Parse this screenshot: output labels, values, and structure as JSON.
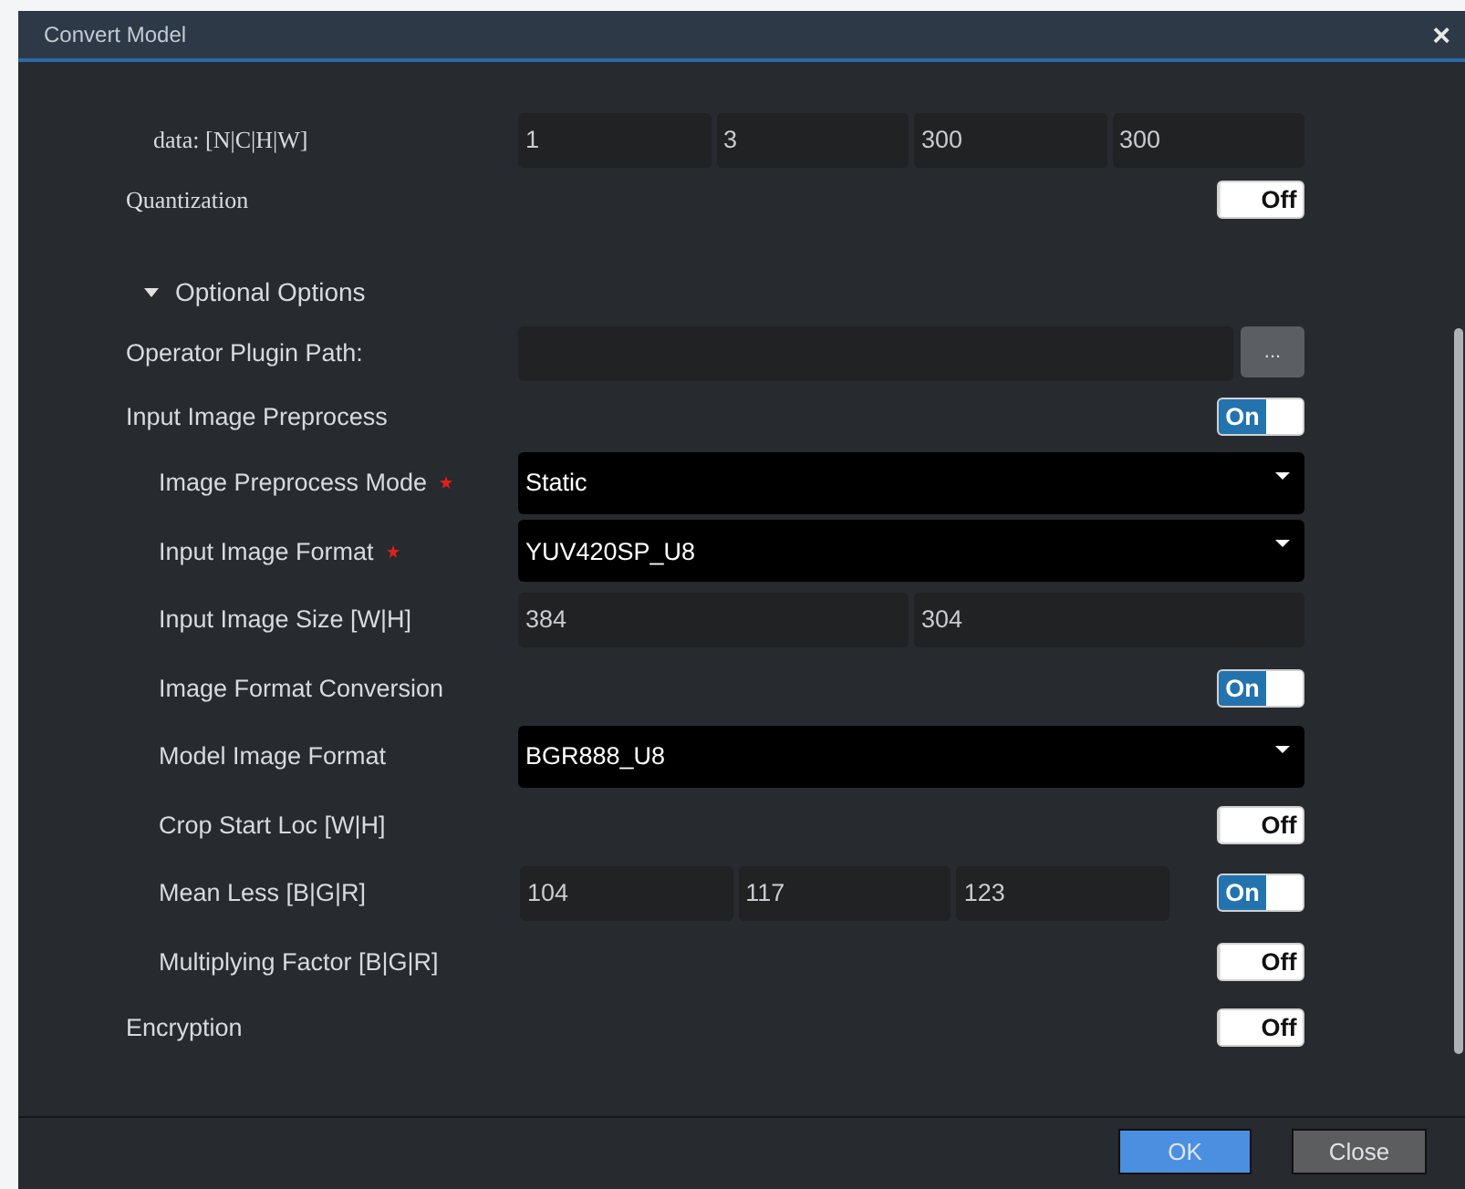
{
  "window": {
    "title": "Convert Model",
    "close": "×"
  },
  "input_shapes": [
    {
      "label": "data:  [N|C|H|W]",
      "values": [
        "1",
        "3",
        "300",
        "300"
      ]
    }
  ],
  "quantization": {
    "label": "Quantization",
    "on": false,
    "toggle_text": "Off"
  },
  "optional_options": {
    "title": "Optional Options",
    "expanded": true,
    "rows": [
      {
        "kind": "path",
        "label": "Operator Plugin Path:",
        "button": "..."
      },
      {
        "kind": "toggle",
        "label": "Input Image Preprocess",
        "on": true,
        "toggle_text": "On",
        "children": [
          {
            "kind": "select",
            "label": "Image Preprocess Mode",
            "required": true,
            "value": "Static"
          },
          {
            "kind": "select",
            "label": "Input Image Format",
            "required": true,
            "value": "YUV420SP_U8"
          },
          {
            "kind": "values",
            "label": "Input Image Size [W|H]",
            "values": [
              "384",
              "304"
            ]
          },
          {
            "kind": "toggle",
            "label": "Image Format Conversion",
            "on": true,
            "toggle_text": "On"
          },
          {
            "kind": "select",
            "label": "Model Image Format",
            "required": false,
            "value": "BGR888_U8"
          },
          {
            "kind": "toggle",
            "label": "Crop Start Loc [W|H]",
            "on": false,
            "toggle_text": "Off"
          },
          {
            "kind": "values_toggle",
            "label": "Mean Less [B|G|R]",
            "values": [
              "104",
              "117",
              "123"
            ],
            "on": true,
            "toggle_text": "On"
          },
          {
            "kind": "toggle",
            "label": "Multiplying Factor [B|G|R]",
            "on": false,
            "toggle_text": "Off"
          }
        ]
      },
      {
        "kind": "toggle",
        "label": "Encryption",
        "on": false,
        "toggle_text": "Off"
      }
    ]
  },
  "buttons": [
    {
      "label": "OK",
      "kind": "primary"
    },
    {
      "label": "Close",
      "kind": "secondary"
    }
  ]
}
